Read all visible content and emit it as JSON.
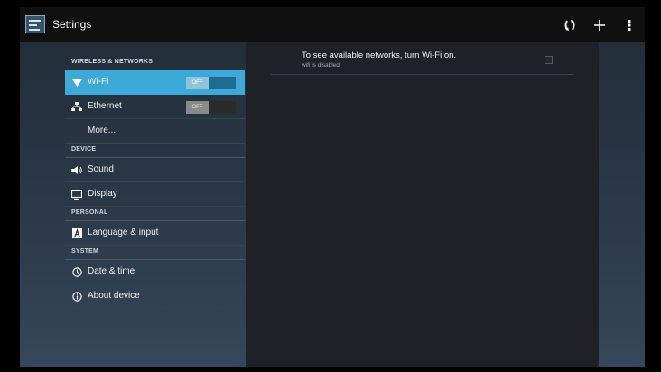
{
  "actionbar": {
    "title": "Settings",
    "icons": [
      "settings-app-icon",
      "auto-rotate-icon",
      "add-icon",
      "overflow-menu-icon"
    ]
  },
  "sidebar": {
    "sections": [
      {
        "header": "WIRELESS & NETWORKS"
      },
      {
        "header": "DEVICE"
      },
      {
        "header": "PERSONAL"
      },
      {
        "header": "SYSTEM"
      }
    ],
    "items": [
      {
        "label": "Wi-Fi",
        "icon": "wifi-icon",
        "toggle": "OFF",
        "selected": true
      },
      {
        "label": "Ethernet",
        "icon": "ethernet-icon",
        "toggle": "OFF"
      },
      {
        "label": "More..."
      },
      {
        "label": "Sound",
        "icon": "speaker-icon"
      },
      {
        "label": "Display",
        "icon": "display-icon"
      },
      {
        "label": "Language & input",
        "icon": "keyboard-icon"
      },
      {
        "label": "Date & time",
        "icon": "clock-icon"
      },
      {
        "label": "About device",
        "icon": "info-icon"
      }
    ]
  },
  "detail": {
    "message": "To see available networks, turn Wi-Fi on.",
    "subtext": "wifi is disabled",
    "wifi_checked": false
  },
  "colors": {
    "accent": "#3ca9d8",
    "actionbar": "#101010",
    "detail_background": "#1e2226"
  }
}
